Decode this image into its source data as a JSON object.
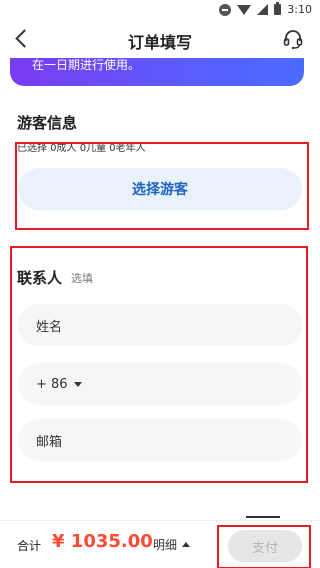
{
  "status": {
    "time": "3:10"
  },
  "nav": {
    "title": "订单填写"
  },
  "banner": {
    "text": "在一日期进行使用。"
  },
  "guest": {
    "title": "游客信息",
    "count_text": "已选择   0成人  0儿童  0老年人",
    "select_button": "选择游客"
  },
  "contact": {
    "title": "联系人",
    "optional": "选填",
    "name_placeholder": "姓名",
    "phone_code": "+ 86",
    "email_placeholder": "邮箱"
  },
  "bottom": {
    "total_label": "合计",
    "total_value": "¥ 1035.00",
    "detail_label": "明细",
    "pay_button": "支付"
  },
  "colors": {
    "accent": "#1d63c4",
    "price": "#ff4a36",
    "highlight": "#e51c23",
    "banner_start": "#7b3cf2",
    "banner_end": "#4b6bff"
  }
}
